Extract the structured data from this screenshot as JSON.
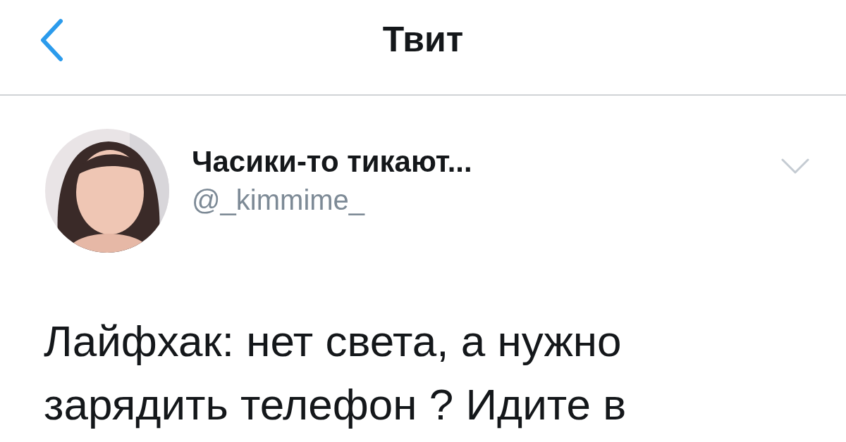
{
  "header": {
    "title": "Твит"
  },
  "tweet": {
    "author": {
      "name": "Часики-то тикают...",
      "handle": "@_kimmime_"
    },
    "text": "Лайфхак: нет света, а нужно зарядить телефон ? Идите в"
  }
}
